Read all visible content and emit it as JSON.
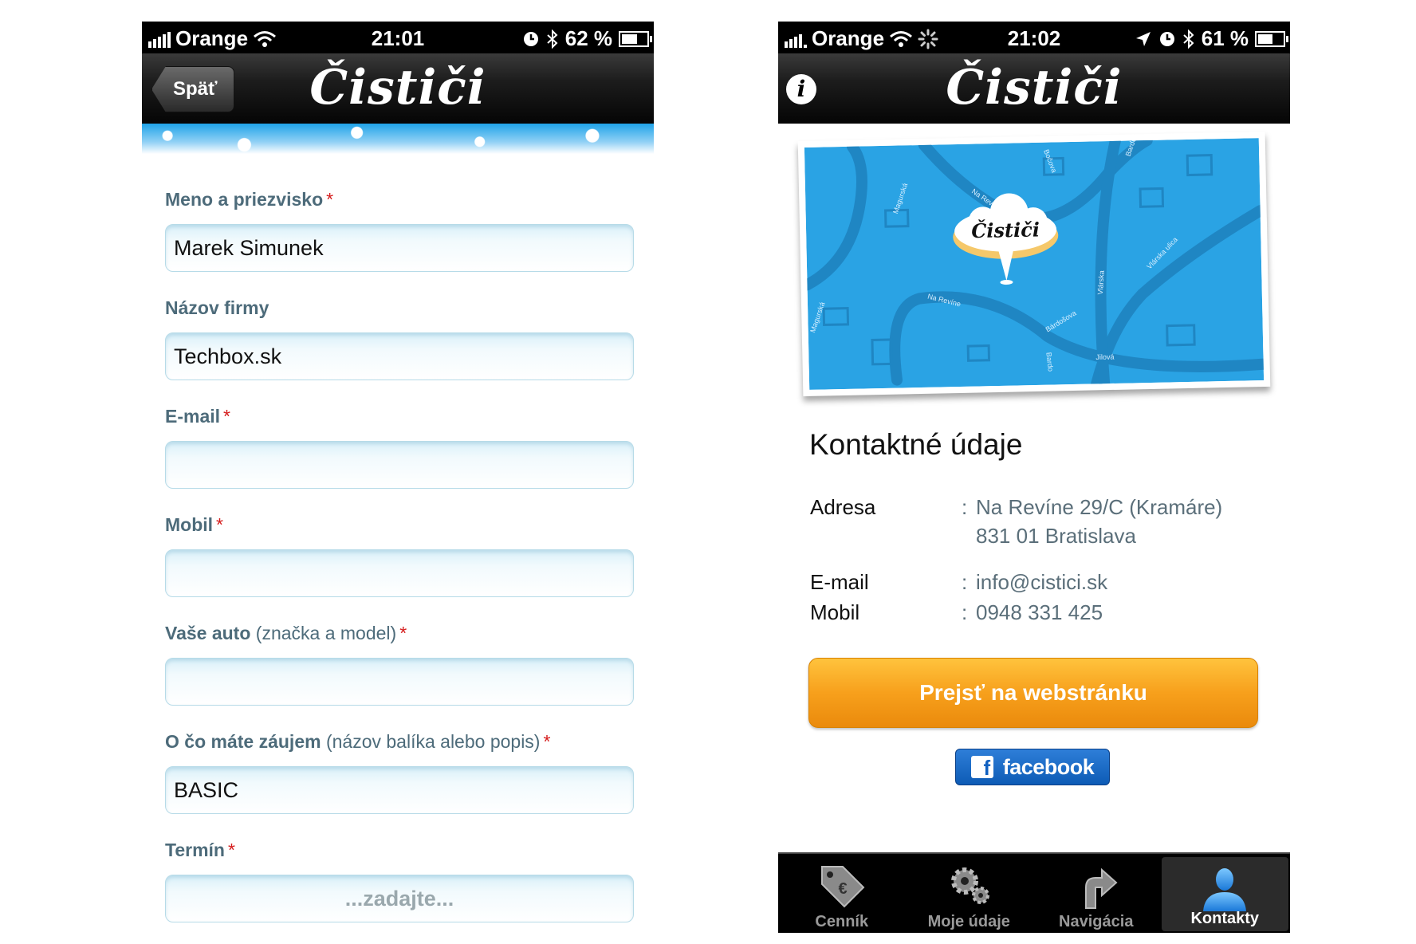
{
  "left_phone": {
    "status": {
      "carrier": "Orange",
      "time": "21:01",
      "battery_text": "62 %",
      "battery_level": 0.62
    },
    "nav": {
      "back_label": "Späť",
      "logo_text": "Čističi"
    },
    "form": {
      "name": {
        "label": "Meno a priezvisko",
        "required": "*",
        "value": "Marek Simunek"
      },
      "company": {
        "label": "Názov firmy",
        "value": "Techbox.sk"
      },
      "email": {
        "label": "E-mail",
        "required": "*",
        "value": ""
      },
      "mobile": {
        "label": "Mobil",
        "required": "*",
        "value": ""
      },
      "car": {
        "label": "Vaše auto",
        "hint": "(značka a model)",
        "required": "*",
        "value": ""
      },
      "interest": {
        "label": "O čo máte záujem",
        "hint": "(názov balíka alebo popis)",
        "required": "*",
        "value": "BASIC"
      },
      "term": {
        "label": "Termín",
        "required": "*",
        "placeholder": "...zadajte..."
      }
    }
  },
  "right_phone": {
    "status": {
      "carrier": "Orange",
      "time": "21:02",
      "battery_text": "61 %",
      "battery_level": 0.61
    },
    "nav": {
      "logo_text": "Čističi",
      "info_icon": "i"
    },
    "map": {
      "logo_text": "Čističi",
      "streets": [
        "Magurská",
        "Na Revíne",
        "Bočova",
        "Bardo",
        "Magurská",
        "Na Revíne",
        "Bárdošova",
        "Vlárska",
        "Vlárska ulica",
        "Bardo",
        "Jilová"
      ]
    },
    "contacts": {
      "title": "Kontaktné údaje",
      "address_label": "Adresa",
      "address_line1": "Na Revíne 29/C (Kramáre)",
      "address_line2": "831 01 Bratislava",
      "email_label": "E-mail",
      "email_value": "info@cistici.sk",
      "mobile_label": "Mobil",
      "mobile_value": "0948 331 425",
      "separator": ":"
    },
    "web_button": "Prejsť na webstránku",
    "facebook_button": "facebook",
    "tabs": [
      {
        "label": "Cenník",
        "icon": "price-tag-icon",
        "active": false
      },
      {
        "label": "Moje údaje",
        "icon": "gears-icon",
        "active": false
      },
      {
        "label": "Navigácia",
        "icon": "turn-arrow-icon",
        "active": false
      },
      {
        "label": "Kontakty",
        "icon": "person-icon",
        "active": true
      }
    ],
    "colors": {
      "accent_orange": "#f7a01c",
      "facebook_blue": "#1565c8",
      "map_blue": "#2aa3e4",
      "label_grey": "#4d6b7a"
    }
  }
}
